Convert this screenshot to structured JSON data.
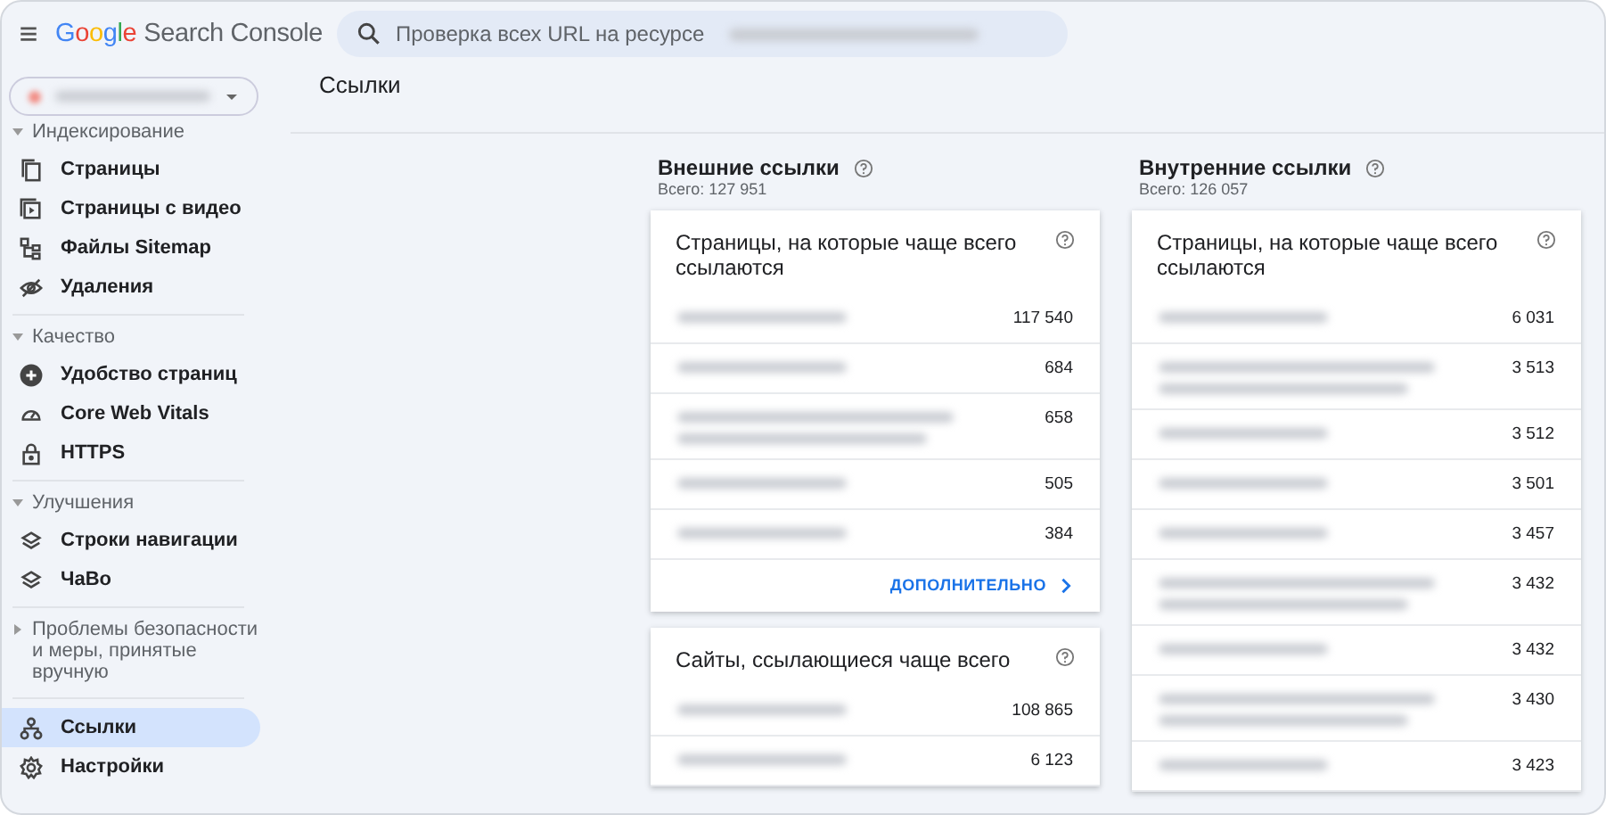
{
  "header": {
    "menu": "≡",
    "logo_brand": "Google",
    "logo_product": "Search Console",
    "search": {
      "placeholder": "Проверка всех URL на ресурсе"
    }
  },
  "sidebar": {
    "groups": [
      {
        "label": "Индексирование",
        "expanded": true,
        "items": [
          {
            "label": "Страницы",
            "selected": false
          },
          {
            "label": "Страницы с видео",
            "selected": false
          },
          {
            "label": "Файлы Sitemap",
            "selected": false
          },
          {
            "label": "Удаления",
            "selected": false
          }
        ]
      },
      {
        "label": "Качество",
        "expanded": true,
        "items": [
          {
            "label": "Удобство страниц",
            "selected": false
          },
          {
            "label": "Core Web Vitals",
            "selected": false
          },
          {
            "label": "HTTPS",
            "selected": false
          }
        ]
      },
      {
        "label": "Улучшения",
        "expanded": true,
        "items": [
          {
            "label": "Строки навигации",
            "selected": false
          },
          {
            "label": "ЧаВо",
            "selected": false
          }
        ]
      },
      {
        "label": "Проблемы безопасности и меры, принятые вручную",
        "expanded": false
      },
      {
        "items": [
          {
            "label": "Ссылки",
            "selected": true
          },
          {
            "label": "Настройки",
            "selected": false
          }
        ]
      }
    ]
  },
  "page_title": "Ссылки",
  "columns": [
    {
      "title": "Внешние ссылки",
      "total": "Всего: 127 951",
      "cards": [
        {
          "title": "Страницы, на которые чаще всего ссылаются",
          "more": "ДОПОЛНИТЕЛЬНО",
          "rows": [
            {
              "kind": "short",
              "count": "117 540"
            },
            {
              "kind": "short",
              "count": "684"
            },
            {
              "kind": "long",
              "count": "658"
            },
            {
              "kind": "short",
              "count": "505"
            },
            {
              "kind": "short",
              "count": "384"
            }
          ]
        },
        {
          "title": "Сайты, ссылающиеся чаще всего",
          "rows": [
            {
              "kind": "short",
              "count": "108 865"
            },
            {
              "kind": "short",
              "count": "6 123"
            }
          ]
        }
      ]
    },
    {
      "title": "Внутренние ссылки",
      "total": "Всего: 126 057",
      "cards": [
        {
          "title": "Страницы, на которые чаще всего ссылаются",
          "rows": [
            {
              "kind": "short",
              "count": "6 031"
            },
            {
              "kind": "long",
              "count": "3 513"
            },
            {
              "kind": "short",
              "count": "3 512"
            },
            {
              "kind": "short",
              "count": "3 501"
            },
            {
              "kind": "short",
              "count": "3 457"
            },
            {
              "kind": "long",
              "count": "3 432"
            },
            {
              "kind": "short",
              "count": "3 432"
            },
            {
              "kind": "long",
              "count": "3 430"
            },
            {
              "kind": "short",
              "count": "3 423"
            }
          ]
        }
      ]
    }
  ]
}
